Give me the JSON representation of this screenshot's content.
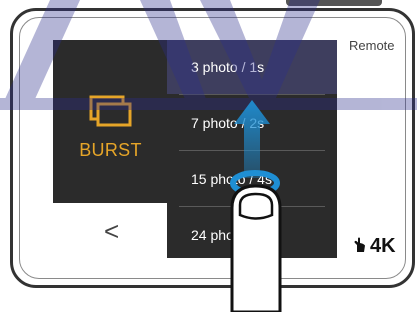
{
  "screen": {
    "remote_label": "Remote",
    "resolution_label": "4K",
    "mode_name": "BURST",
    "back_glyph": "<"
  },
  "menu": {
    "items": [
      {
        "label": "3 photo / 1s",
        "selected": true
      },
      {
        "label": "7 photo / 2s",
        "selected": false
      },
      {
        "label": "15 photo / 4s",
        "selected": false
      },
      {
        "label": "24 photo / 8s",
        "selected": false
      }
    ]
  },
  "icons": {
    "mode_icon": "burst-icon",
    "remote_hand_icon": "hand-icon",
    "gesture": "swipe-up-finger-icon"
  },
  "colors": {
    "panel_bg": "#2b2b2b",
    "selected_bg": "#3e3e5e",
    "accent_orange": "#e6a528",
    "swipe_arrow": "#1f8fd4",
    "watermark_blue": "#2b2d8c"
  }
}
